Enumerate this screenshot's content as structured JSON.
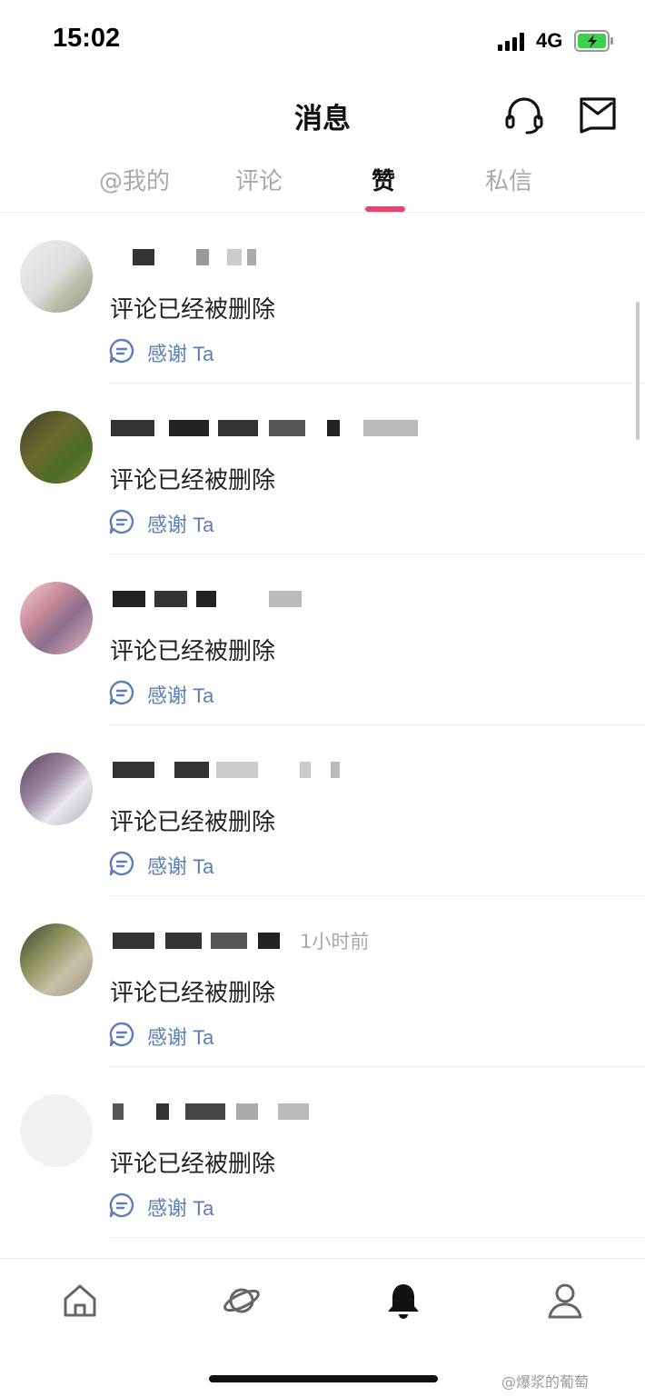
{
  "status_bar": {
    "time": "15:02",
    "network": "4G"
  },
  "header": {
    "title": "消息"
  },
  "tabs": [
    {
      "label": "@我的",
      "active": false
    },
    {
      "label": "评论",
      "active": false
    },
    {
      "label": "赞",
      "active": true
    },
    {
      "label": "私信",
      "active": false
    }
  ],
  "items": [
    {
      "comment": "评论已经被删除",
      "action_label": "感谢 Ta",
      "time": ""
    },
    {
      "comment": "评论已经被删除",
      "action_label": "感谢 Ta",
      "time": ""
    },
    {
      "comment": "评论已经被删除",
      "action_label": "感谢 Ta",
      "time": ""
    },
    {
      "comment": "评论已经被删除",
      "action_label": "感谢 Ta",
      "time": ""
    },
    {
      "comment": "评论已经被删除",
      "action_label": "感谢 Ta",
      "time": "1小时前"
    },
    {
      "comment": "评论已经被删除",
      "action_label": "感谢 Ta",
      "time": ""
    }
  ],
  "bottom_nav": [
    {
      "icon": "home-icon",
      "active": false
    },
    {
      "icon": "planet-icon",
      "active": false
    },
    {
      "icon": "bell-icon",
      "active": true
    },
    {
      "icon": "profile-icon",
      "active": false
    }
  ],
  "watermark": "@爆浆的葡萄",
  "colors": {
    "accent": "#ef3f6b",
    "link": "#5b7fb2",
    "tab_inactive": "#a9a9a9"
  }
}
